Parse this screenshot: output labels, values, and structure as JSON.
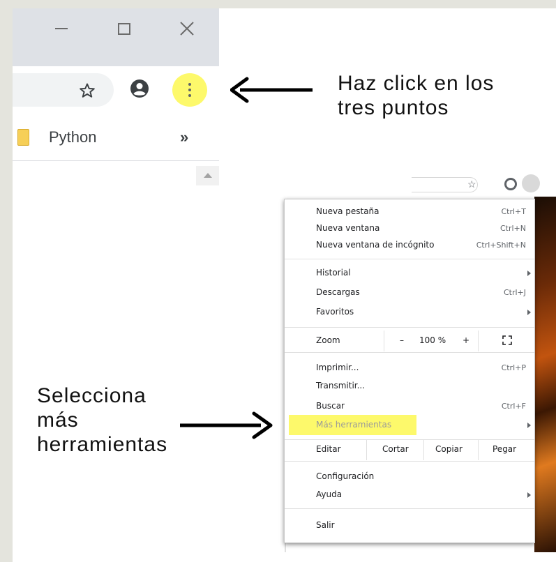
{
  "browser": {
    "window_controls": [
      "minimize",
      "maximize",
      "close"
    ],
    "bookmark_folder": "Python",
    "bookmarks_more": "»",
    "menu_button_color": "#fdf96b"
  },
  "instructions": {
    "top": [
      "Haz click en los",
      "tres puntos"
    ],
    "left": [
      "Selecciona",
      "más",
      "herramientas"
    ]
  },
  "menu": {
    "group1": [
      {
        "label": "Nueva pestaña",
        "shortcut": "Ctrl+T"
      },
      {
        "label": "Nueva ventana",
        "shortcut": "Ctrl+N"
      },
      {
        "label": "Nueva ventana de incógnito",
        "shortcut": "Ctrl+Shift+N"
      }
    ],
    "group2": [
      {
        "label": "Historial",
        "shortcut": ""
      },
      {
        "label": "Descargas",
        "shortcut": "Ctrl+J"
      },
      {
        "label": "Favoritos",
        "shortcut": ""
      }
    ],
    "zoom": {
      "label": "Zoom",
      "minus": "–",
      "value": "100 %",
      "plus": "+"
    },
    "group3": [
      {
        "label": "Imprimir...",
        "shortcut": "Ctrl+P"
      },
      {
        "label": "Transmitir...",
        "shortcut": ""
      },
      {
        "label": "Buscar",
        "shortcut": "Ctrl+F"
      },
      {
        "label": "Más herramientas",
        "shortcut": ""
      }
    ],
    "edit": {
      "label": "Editar",
      "cut": "Cortar",
      "copy": "Copiar",
      "paste": "Pegar"
    },
    "group4": [
      {
        "label": "Configuración",
        "shortcut": ""
      },
      {
        "label": "Ayuda",
        "shortcut": ""
      }
    ],
    "exit": {
      "label": "Salir"
    },
    "highlight_color": "#fdf96b"
  }
}
